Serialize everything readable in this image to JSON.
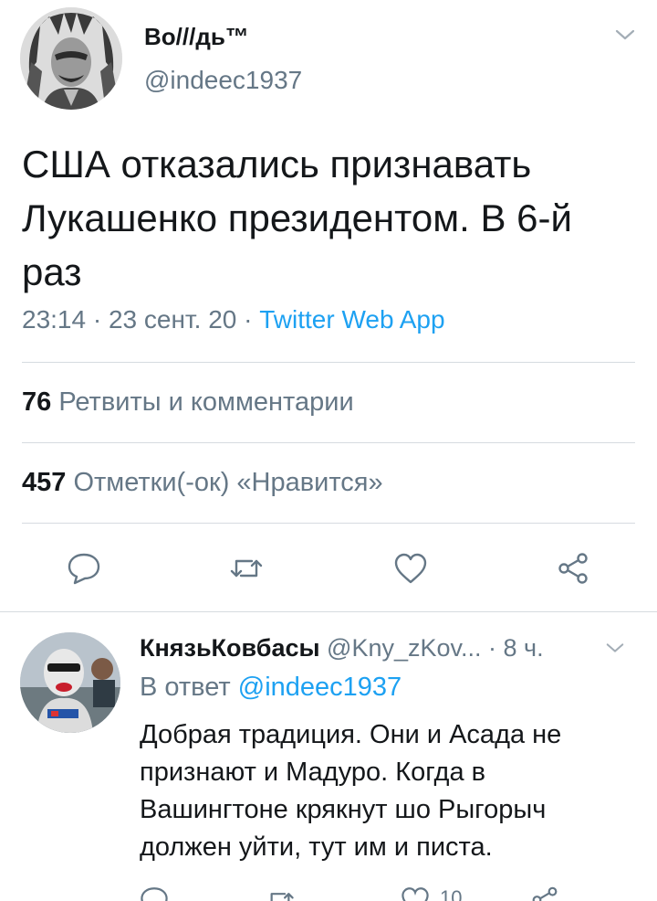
{
  "tweet": {
    "display_name": "Во///дь™",
    "handle": "@indeec1937",
    "text": "США отказались признавать Лукашенко президентом. В 6-й раз",
    "time": "23:14 · 23 сент. 20 · ",
    "source": "Twitter Web App",
    "retweets_count": "76",
    "retweets_label": " Ретвиты и комментарии",
    "likes_count": "457",
    "likes_label": " Отметки(-ок) «Нравится»"
  },
  "reply": {
    "display_name": "КнязьКовбасы",
    "handle_time": " @Kny_zKov... · 8 ч.",
    "reply_to_label": "В ответ ",
    "reply_to_mention": "@indeec1937",
    "text": "Добрая традиция. Они и Асада не признают и Мадуро. Когда в Вашингтоне крякнут шо Рыгорыч должен уйти, тут им и писта.",
    "likes_count": "10"
  },
  "icons": {
    "reply": "comment-icon",
    "retweet": "retweet-icon",
    "like": "heart-icon",
    "share": "share-icon",
    "menu": "chevron-down-icon"
  },
  "colors": {
    "accent": "#1da1f2",
    "secondary_text": "#657786",
    "divider": "#d6dbe0"
  }
}
